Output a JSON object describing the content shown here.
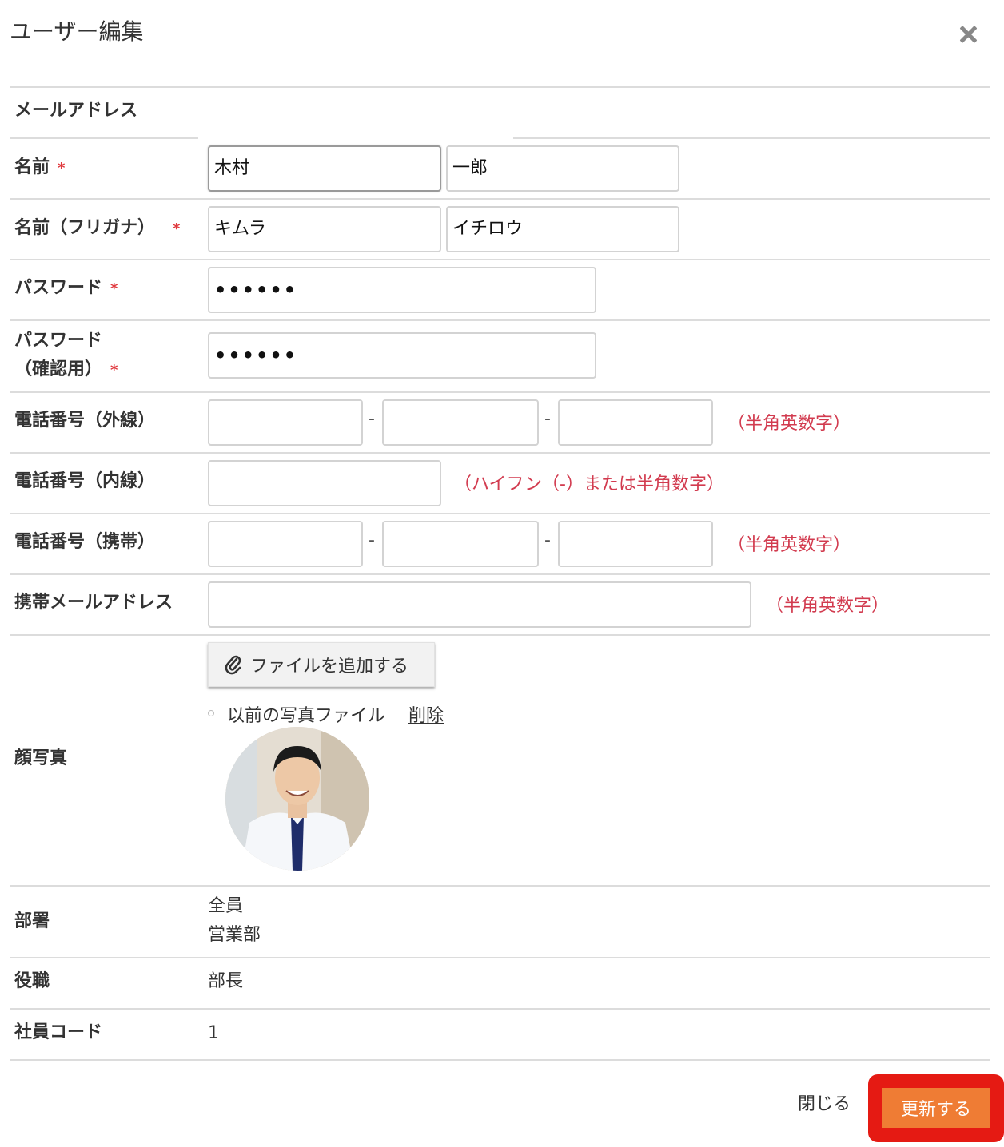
{
  "dialog": {
    "title": "ユーザー編集"
  },
  "labels": {
    "email": "メールアドレス",
    "name": "名前",
    "furigana": "名前（フリガナ）",
    "password": "パスワード",
    "password_confirm_1": "パスワード",
    "password_confirm_2": "（確認用）",
    "phone_external": "電話番号（外線）",
    "phone_internal": "電話番号（内線）",
    "phone_mobile": "電話番号（携帯）",
    "mobile_email": "携帯メールアドレス",
    "photo": "顔写真",
    "department": "部署",
    "position": "役職",
    "employee_code": "社員コード"
  },
  "required_mark": "*",
  "fields": {
    "last_name": "木村",
    "first_name": "一郎",
    "last_name_kana": "キムラ",
    "first_name_kana": "イチロウ",
    "password_mask": "••••••",
    "password_confirm_mask": "••••••",
    "dash": "-"
  },
  "hints": {
    "alnum": "（半角英数字）",
    "internal": "（ハイフン（-）または半角数字）"
  },
  "photo": {
    "add_file_label": "ファイルを追加する",
    "previous_file_label": "以前の写真ファイル",
    "delete_label": "削除"
  },
  "info": {
    "departments": [
      "全員",
      "営業部"
    ],
    "position": "部長",
    "employee_code": "1"
  },
  "footer": {
    "close_label": "閉じる",
    "update_label": "更新する"
  },
  "colors": {
    "required": "#e0393e",
    "hint": "#d23b4f",
    "update_button": "#ef7c34",
    "highlight": "#e51a13"
  }
}
